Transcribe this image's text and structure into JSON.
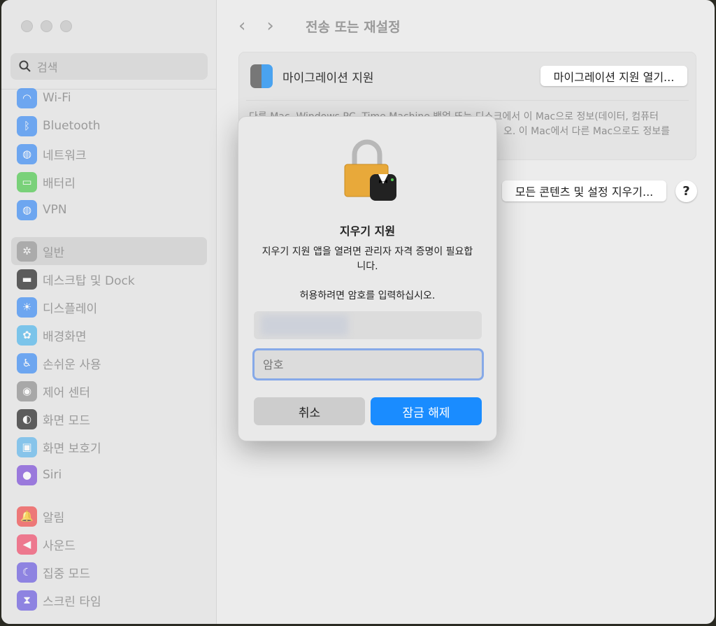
{
  "window": {
    "title": "전송 또는 재설정"
  },
  "sidebar": {
    "search_placeholder": "검색",
    "items": [
      {
        "label": "Wi-Fi",
        "icon": "wifi-icon",
        "color": "#3b8cf5"
      },
      {
        "label": "Bluetooth",
        "icon": "bluetooth-icon",
        "color": "#3b8cf5"
      },
      {
        "label": "네트워크",
        "icon": "globe-icon",
        "color": "#3b8cf5"
      },
      {
        "label": "배터리",
        "icon": "battery-icon",
        "color": "#4cc94c"
      },
      {
        "label": "VPN",
        "icon": "vpn-globe-icon",
        "color": "#3b8cf5"
      },
      {
        "label": "일반",
        "icon": "gear-icon",
        "color": "#9a9a9a",
        "selected": true
      },
      {
        "label": "데스크탑 및 Dock",
        "icon": "dock-icon",
        "color": "#222222"
      },
      {
        "label": "디스플레이",
        "icon": "sun-icon",
        "color": "#3b8cf5"
      },
      {
        "label": "배경화면",
        "icon": "flower-icon",
        "color": "#4fb6ec"
      },
      {
        "label": "손쉬운 사용",
        "icon": "accessibility-icon",
        "color": "#3b8cf5"
      },
      {
        "label": "제어 센터",
        "icon": "toggles-icon",
        "color": "#8e8e8e"
      },
      {
        "label": "화면 모드",
        "icon": "appearance-icon",
        "color": "#222222"
      },
      {
        "label": "화면 보호기",
        "icon": "screensaver-icon",
        "color": "#5fb6ec"
      },
      {
        "label": "Siri",
        "icon": "siri-icon",
        "color": "#7a4bd8"
      },
      {
        "label": "알림",
        "icon": "bell-icon",
        "color": "#f04a4a"
      },
      {
        "label": "사운드",
        "icon": "speaker-icon",
        "color": "#f04a6a"
      },
      {
        "label": "집중 모드",
        "icon": "moon-icon",
        "color": "#6a5ae0"
      },
      {
        "label": "스크린 타임",
        "icon": "hourglass-icon",
        "color": "#6a5ae0"
      }
    ]
  },
  "main": {
    "migration_label": "마이그레이션 지원",
    "migration_button": "마이그레이션 지원 열기...",
    "description_line1": "다른 Mac, Windows PC, Time Machine 백업 또는 디스크에서 이 Mac으로 정보(데이터, 컴퓨터",
    "description_line2": "오. 이 Mac에서 다른 Mac으로도 정보를",
    "erase_button": "모든 콘텐츠 및 설정 지우기...",
    "help_label": "?"
  },
  "dialog": {
    "title": "지우기 지원",
    "message": "지우기 지원 앱을 열려면 관리자 자격 증명이 필요합니다.",
    "prompt": "허용하려면 암호를 입력하십시오.",
    "password_placeholder": "암호",
    "cancel": "취소",
    "unlock": "잠금 해제",
    "accent": "#1a8cff"
  }
}
